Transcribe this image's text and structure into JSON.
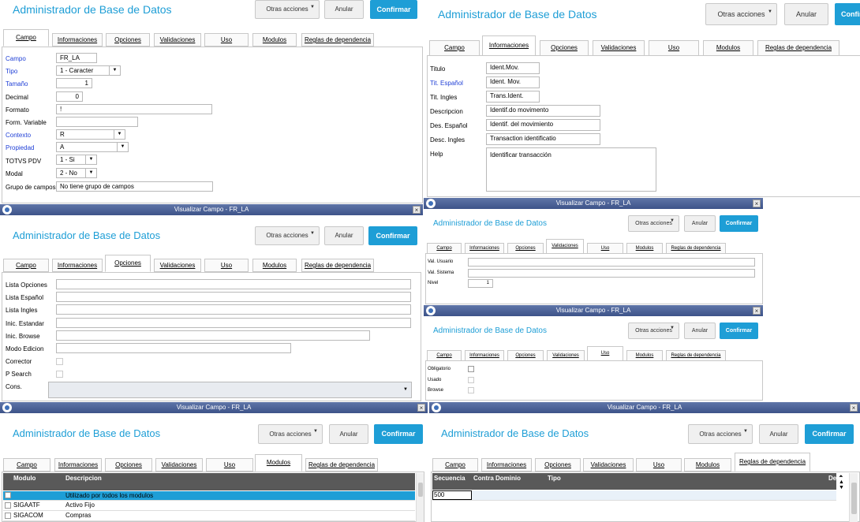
{
  "app": {
    "title": "Administrador de Base de Datos",
    "otras_acciones": "Otras acciones",
    "anular": "Anular",
    "confirmar": "Confirmar",
    "window_title": "Visualizar Campo - FR_LA",
    "close_glyph": "×"
  },
  "tabs": [
    "Campo",
    "Informaciones",
    "Opciones",
    "Validaciones",
    "Uso",
    "Modulos",
    "Reglas de dependencia"
  ],
  "campo": {
    "labels": [
      "Campo",
      "Tipo",
      "Tamaño",
      "Decimal",
      "Formato",
      "Form. Variable",
      "Contexto",
      "Propiedad",
      "TOTVS PDV",
      "Modal",
      "Grupo de campos"
    ],
    "values": {
      "campo": "FR_LA",
      "tipo": "1 - Caracter",
      "tamano": "1",
      "decimal": "0",
      "formato": "!",
      "form_variable": "",
      "contexto": "R",
      "propiedad": "A",
      "totvs_pdv": "1 - Si",
      "modal": "2 - No",
      "grupo": "No tiene grupo de campos"
    }
  },
  "informaciones": {
    "labels": [
      "Titulo",
      "Tit. Español",
      "Tit. Ingles",
      "Descripcion",
      "Des. Español",
      "Desc. Ingles",
      "Help"
    ],
    "values": [
      "Ident.Mov.",
      "Ident. Mov.",
      "Trans.Ident.",
      "Identif.do movimento",
      "Identif. del movimiento",
      "Transaction identificatio",
      "Identificar transacción"
    ]
  },
  "opciones": {
    "labels": [
      "Lista Opciones",
      "Lista Español",
      "Lista Ingles",
      "Inic. Estandar",
      "Inic. Browse",
      "Modo Edicion",
      "Corrector",
      "P Search",
      "Cons."
    ]
  },
  "validaciones": {
    "labels": [
      "Val. Usuario",
      "Val. Sistema",
      "Nivel"
    ],
    "nivel": "1"
  },
  "uso": {
    "labels": [
      "Obligatorio",
      "Usado",
      "Browse"
    ]
  },
  "modulos": {
    "headers": [
      "Modulo",
      "Descripcion"
    ],
    "rows": [
      {
        "modulo": "",
        "descripcion": "Utilizado por todos los modulos"
      },
      {
        "modulo": "SIGAATF",
        "descripcion": "Activo Fijo"
      },
      {
        "modulo": "SIGACOM",
        "descripcion": "Compras"
      }
    ]
  },
  "reglas": {
    "headers": [
      "Secuencia",
      "Contra Dominio",
      "Tipo",
      "Des"
    ],
    "row_secuencia": "500"
  },
  "colors": {
    "accent": "#1e9ed6",
    "label_blue": "#1f3fd6",
    "titlebar": "#3d5389",
    "grid_header": "#595959"
  }
}
